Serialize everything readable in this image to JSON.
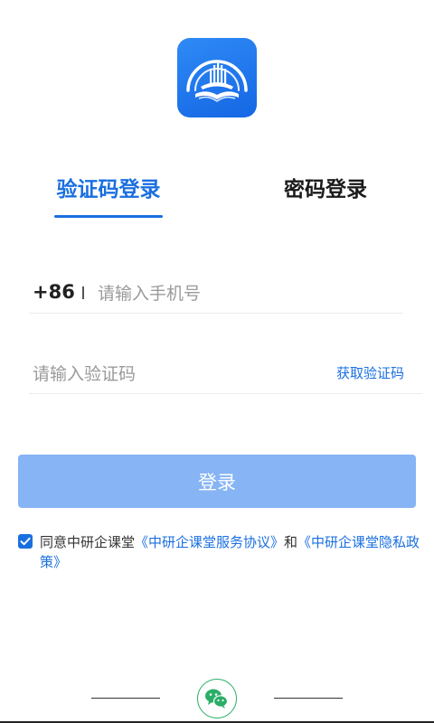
{
  "tabs": {
    "sms_label": "验证码登录",
    "password_label": "密码登录",
    "active": "sms"
  },
  "phone": {
    "country_code": "+86",
    "value": "",
    "placeholder": "请输入手机号"
  },
  "code": {
    "value": "",
    "placeholder": "请输入验证码",
    "get_code_label": "获取验证码"
  },
  "login_button": {
    "label": "登录"
  },
  "agreement": {
    "checked": true,
    "prefix": "同意中研企课堂",
    "service_link": "《中研企课堂服务协议》",
    "conjunction": "和",
    "privacy_link": "《中研企课堂隐私政策》"
  },
  "colors": {
    "accent": "#1a6fe0",
    "button_disabled": "#86b4f5",
    "wechat_green": "#2aae67"
  },
  "icons": {
    "logo": "app-logo-icon",
    "checkbox": "checkbox-checked-icon",
    "wechat": "wechat-icon"
  }
}
